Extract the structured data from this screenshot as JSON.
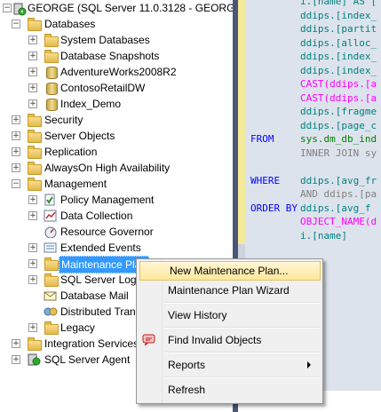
{
  "tree": {
    "server": "GEORGE (SQL Server 11.0.3128 - GEORG",
    "databases": "Databases",
    "system_databases": "System Databases",
    "database_snapshots": "Database Snapshots",
    "db1": "AdventureWorks2008R2",
    "db2": "ContosoRetailDW",
    "db3": "Index_Demo",
    "security": "Security",
    "server_objects": "Server Objects",
    "replication": "Replication",
    "alwayson": "AlwaysOn High Availability",
    "management": "Management",
    "policy_management": "Policy Management",
    "data_collection": "Data Collection",
    "resource_governor": "Resource Governor",
    "extended_events": "Extended Events",
    "maintenance_plans": "Maintenance Plan",
    "sql_server_logs": "SQL Server Logs",
    "database_mail": "Database Mail",
    "distributed_tran": "Distributed Tran",
    "legacy": "Legacy",
    "integration_services": "Integration Services",
    "sql_server_agent": "SQL Server Agent",
    "expand_glyph": "+",
    "collapse_glyph": "−"
  },
  "editor": {
    "lines": [
      [
        "",
        "i.[name] AS ["
      ],
      [
        "",
        "ddips.[index_"
      ],
      [
        "",
        "ddips.[partit"
      ],
      [
        "",
        "ddips.[alloc_"
      ],
      [
        "",
        "ddips.[index_"
      ],
      [
        "",
        "ddips.[index_"
      ],
      [
        "",
        "CAST(ddips.[a"
      ],
      [
        "",
        "CAST(ddips.[a"
      ],
      [
        "",
        "ddips.[fragme"
      ],
      [
        "",
        "ddips.[page_c"
      ],
      [
        "FROM",
        "sys.dm_db_ind"
      ],
      [
        "",
        "INNER JOIN sy"
      ],
      [
        "",
        ""
      ],
      [
        "WHERE",
        "ddips.[avg_fr"
      ],
      [
        "",
        "AND ddips.[pa"
      ],
      [
        "ORDER BY",
        "ddips.[avg_f"
      ],
      [
        "",
        "OBJECT_NAME(d"
      ],
      [
        "",
        "i.[name]"
      ]
    ]
  },
  "context_menu": {
    "new_plan": "New Maintenance Plan...",
    "wizard": "Maintenance Plan Wizard",
    "view_history": "View History",
    "find_invalid": "Find Invalid Objects",
    "reports": "Reports",
    "refresh": "Refresh"
  },
  "colors": {
    "selection": "#3399ff",
    "menu_highlight": "#ffe89a",
    "splitter": "#4a5674",
    "keyword": "#0000ff",
    "function": "#ff00ff",
    "system_object": "#008000"
  }
}
